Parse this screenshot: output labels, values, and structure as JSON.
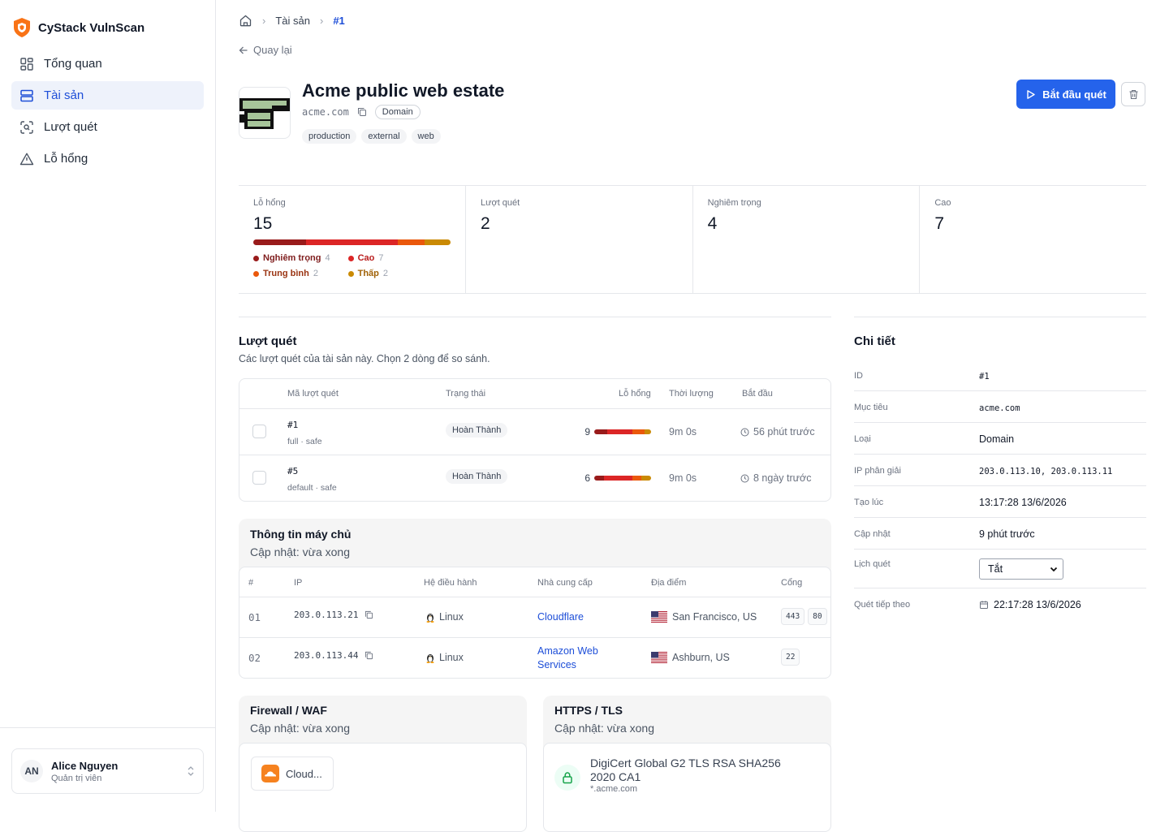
{
  "app": {
    "name": "CyStack VulnScan"
  },
  "sidebar": {
    "items": [
      {
        "label": "Tổng quan",
        "icon": "dashboard-icon"
      },
      {
        "label": "Tài sản",
        "icon": "server-icon"
      },
      {
        "label": "Lượt quét",
        "icon": "scan-icon"
      },
      {
        "label": "Lỗ hổng",
        "icon": "warning-icon"
      }
    ],
    "active": "Tài sản"
  },
  "user": {
    "initials": "AN",
    "name": "Alice Nguyen",
    "role": "Quản trị viên"
  },
  "breadcrumb": {
    "items": [
      "Tài sản",
      "#1"
    ]
  },
  "back_label": "Quay lại",
  "asset": {
    "title": "Acme public web estate",
    "target": "acme.com",
    "type": "Domain",
    "tags": [
      "production",
      "external",
      "web"
    ]
  },
  "actions": {
    "start_scan": "Bắt đầu quét"
  },
  "stats": {
    "vulns": {
      "label": "Lỗ hổng",
      "value": "15"
    },
    "scans": {
      "label": "Lượt quét",
      "value": "2"
    },
    "critical": {
      "label": "Nghiêm trọng",
      "value": "4"
    },
    "high": {
      "label": "Cao",
      "value": "7"
    }
  },
  "severity": [
    {
      "name": "Nghiêm trọng",
      "count": "4",
      "color": "#991b1b",
      "text_color": "#7f1d1d"
    },
    {
      "name": "Cao",
      "count": "7",
      "color": "#dc2626",
      "text_color": "#b91c1c"
    },
    {
      "name": "Trung bình",
      "count": "2",
      "color": "#ea580c",
      "text_color": "#9a3412"
    },
    {
      "name": "Thấp",
      "count": "2",
      "color": "#ca8a04",
      "text_color": "#a16207"
    }
  ],
  "scans": {
    "title": "Lượt quét",
    "description": "Các lượt quét của tài sản này. Chọn 2 dòng để so sánh.",
    "columns": [
      "Mã lượt quét",
      "Trạng thái",
      "Lỗ hổng",
      "Thời lượng",
      "Bắt đầu"
    ],
    "rows": [
      {
        "id": "#1",
        "meta": "full · safe",
        "status": "Hoàn Thành",
        "vulns": "9",
        "duration": "9m 0s",
        "started": "56 phút trước",
        "bar": [
          2,
          4,
          2,
          1
        ]
      },
      {
        "id": "#5",
        "meta": "default · safe",
        "status": "Hoàn Thành",
        "vulns": "6",
        "duration": "9m 0s",
        "started": "8 ngày trước",
        "bar": [
          1,
          3,
          1,
          1
        ]
      }
    ]
  },
  "hosts": {
    "title": "Thông tin máy chủ",
    "updated": "Cập nhật: vừa xong",
    "columns": [
      "#",
      "IP",
      "Hệ điều hành",
      "Nhà cung cấp",
      "Địa điểm",
      "Cổng"
    ],
    "rows": [
      {
        "num": "01",
        "ip": "203.0.113.21",
        "os": "Linux",
        "provider": "Cloudflare",
        "location": "San Francisco, US",
        "ports": [
          "443",
          "80"
        ]
      },
      {
        "num": "02",
        "ip": "203.0.113.44",
        "os": "Linux",
        "provider": "Amazon Web Services",
        "location": "Ashburn, US",
        "ports": [
          "22"
        ]
      }
    ]
  },
  "waf": {
    "title": "Firewall / WAF",
    "updated": "Cập nhật: vừa xong",
    "item": "Cloud..."
  },
  "tls": {
    "title": "HTTPS / TLS",
    "updated": "Cập nhật: vừa xong",
    "issuer": "DigiCert Global G2 TLS RSA SHA256 2020 CA1",
    "domain": "*.acme.com"
  },
  "details": {
    "title": "Chi tiết",
    "rows": [
      {
        "label": "ID",
        "value": "#1",
        "mono": true
      },
      {
        "label": "Mục tiêu",
        "value": "acme.com",
        "mono": true
      },
      {
        "label": "Loại",
        "value": "Domain"
      },
      {
        "label": "IP phân giải",
        "value": "203.0.113.10, 203.0.113.11",
        "mono": true
      },
      {
        "label": "Tạo lúc",
        "value": "13:17:28 13/6/2026"
      },
      {
        "label": "Cập nhật",
        "value": "9 phút trước"
      },
      {
        "label": "Lịch quét",
        "value": "Tắt",
        "select": true
      },
      {
        "label": "Quét tiếp theo",
        "value": "22:17:28 13/6/2026",
        "calendar": true
      }
    ]
  }
}
